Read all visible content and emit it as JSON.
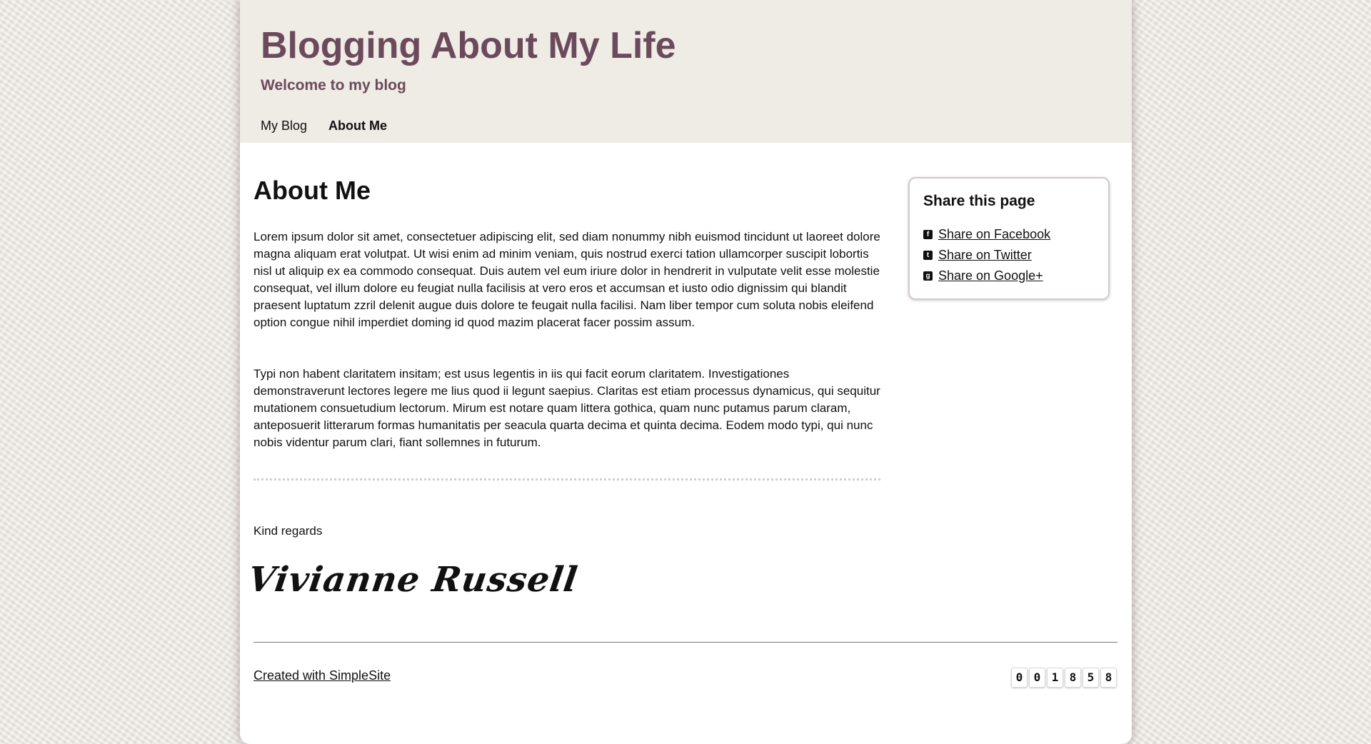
{
  "header": {
    "title": "Blogging About My Life",
    "subtitle": "Welcome to my blog",
    "nav": [
      {
        "label": "My Blog"
      },
      {
        "label": "About Me"
      }
    ]
  },
  "main": {
    "heading": "About Me",
    "paragraphs": [
      "Lorem ipsum dolor sit amet, consectetuer adipiscing elit, sed diam nonummy nibh euismod tincidunt ut laoreet dolore magna aliquam erat volutpat. Ut wisi enim ad minim veniam, quis nostrud exerci tation ullamcorper suscipit lobortis nisl ut aliquip ex ea commodo consequat. Duis autem vel eum iriure dolor in hendrerit in vulputate velit esse molestie consequat, vel illum dolore eu feugiat nulla facilisis at vero eros et accumsan et iusto odio dignissim qui blandit praesent luptatum zzril delenit augue duis dolore te feugait nulla facilisi. Nam liber tempor cum soluta nobis eleifend option congue nihil imperdiet doming id quod mazim placerat facer possim assum.",
      "Typi non habent claritatem insitam; est usus legentis in iis qui facit eorum claritatem. Investigationes demonstraverunt lectores legere me lius quod ii legunt saepius. Claritas est etiam processus dynamicus, qui sequitur mutationem consuetudium lectorum. Mirum est notare quam littera gothica, quam nunc putamus parum claram, anteposuerit litterarum formas humanitatis per seacula quarta decima et quinta decima. Eodem modo typi, qui nunc nobis videntur parum clari, fiant sollemnes in futurum."
    ],
    "regards": "Kind regards",
    "signature": "Vivianne Russell"
  },
  "share": {
    "title": "Share this page",
    "items": [
      {
        "label": "Share on Facebook",
        "icon": "facebook-icon"
      },
      {
        "label": "Share on Twitter",
        "icon": "twitter-icon"
      },
      {
        "label": "Share on Google+",
        "icon": "google-plus-icon"
      }
    ]
  },
  "footer": {
    "created": "Created with SimpleSite",
    "counter": [
      "0",
      "0",
      "1",
      "8",
      "5",
      "8"
    ]
  }
}
